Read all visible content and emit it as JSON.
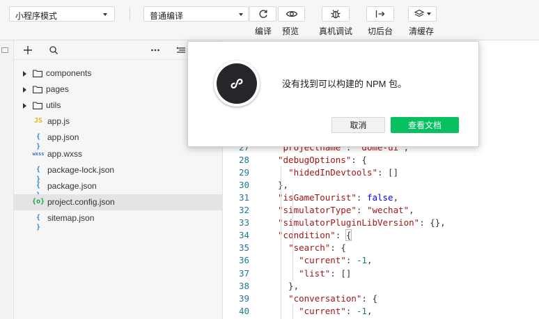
{
  "toolbar": {
    "mode_select": {
      "value": "小程序模式"
    },
    "compile_select": {
      "value": "普通编译"
    },
    "buttons": {
      "compile": "编译",
      "preview": "预览",
      "remote_debug": "真机调试",
      "switch_background": "切后台",
      "clear_cache": "清缓存"
    }
  },
  "explorer": {
    "items": [
      {
        "name": "components",
        "type": "folder"
      },
      {
        "name": "pages",
        "type": "folder"
      },
      {
        "name": "utils",
        "type": "folder"
      },
      {
        "name": "app.js",
        "type": "js",
        "badge": "JS"
      },
      {
        "name": "app.json",
        "type": "json",
        "badge": "{ }"
      },
      {
        "name": "app.wxss",
        "type": "wxss",
        "badge": "wxss"
      },
      {
        "name": "package-lock.json",
        "type": "json",
        "badge": "{ }"
      },
      {
        "name": "package.json",
        "type": "json",
        "badge": "{ }"
      },
      {
        "name": "project.config.json",
        "type": "config",
        "badge": "{o}",
        "selected": true
      },
      {
        "name": "sitemap.json",
        "type": "json",
        "badge": "{ }"
      }
    ]
  },
  "editor": {
    "lines": [
      {
        "n": "27",
        "text": "\"projectname\": \"dome-ui\","
      },
      {
        "n": "28",
        "text": "\"debugOptions\": {"
      },
      {
        "n": "29",
        "text": "  \"hidedInDevtools\": []"
      },
      {
        "n": "30",
        "text": "},"
      },
      {
        "n": "31",
        "text": "\"isGameTourist\": false,"
      },
      {
        "n": "32",
        "text": "\"simulatorType\": \"wechat\","
      },
      {
        "n": "33",
        "text": "\"simulatorPluginLibVersion\": {},"
      },
      {
        "n": "34",
        "text": "\"condition\": {"
      },
      {
        "n": "35",
        "text": "  \"search\": {"
      },
      {
        "n": "36",
        "text": "    \"current\": -1,"
      },
      {
        "n": "37",
        "text": "    \"list\": []"
      },
      {
        "n": "38",
        "text": "  },"
      },
      {
        "n": "39",
        "text": "  \"conversation\": {"
      },
      {
        "n": "40",
        "text": "    \"current\": -1,"
      }
    ]
  },
  "dialog": {
    "message": "没有找到可以构建的 NPM 包。",
    "cancel_label": "取消",
    "docs_label": "查看文档",
    "accent": "#07c160"
  }
}
